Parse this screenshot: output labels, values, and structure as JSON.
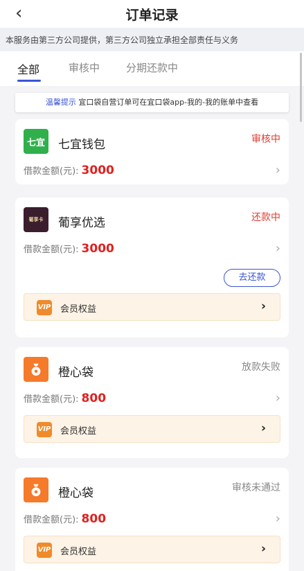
{
  "header": {
    "back_icon": "‹",
    "title": "订单记录"
  },
  "notice": "本服务由第三方公司提供，第三方公司独立承担全部责任与义务",
  "tabs": [
    {
      "label": "全部",
      "active": true
    },
    {
      "label": "审核中",
      "active": false
    },
    {
      "label": "分期还款中",
      "active": false
    }
  ],
  "tip": {
    "label": "温馨提示",
    "text": "宜口袋自营订单可在宜口袋app-我的-我的账单中查看"
  },
  "amount_label": "借款金额(元):",
  "perk_label": "会员权益",
  "vip_badge": "VIP",
  "orders": [
    {
      "logo_text": "七宜",
      "logo_color": "#2fb04b",
      "name": "七宜钱包",
      "status": "审核中",
      "status_color": "#e23b2e",
      "amount": "3000"
    },
    {
      "logo_text": "葡享卡",
      "logo_color": "#3a1e2e",
      "name": "葡享优选",
      "status": "还款中",
      "status_color": "#e23b2e",
      "amount": "3000",
      "action": "去还款"
    },
    {
      "logo_icon": "moneybag-icon",
      "logo_color": "#f57a2a",
      "name": "橙心袋",
      "status": "放款失败",
      "status_color": "#888888",
      "amount": "800"
    },
    {
      "logo_icon": "moneybag-icon",
      "logo_color": "#f57a2a",
      "name": "橙心袋",
      "status": "审核未通过",
      "status_color": "#888888",
      "amount": "800"
    }
  ]
}
